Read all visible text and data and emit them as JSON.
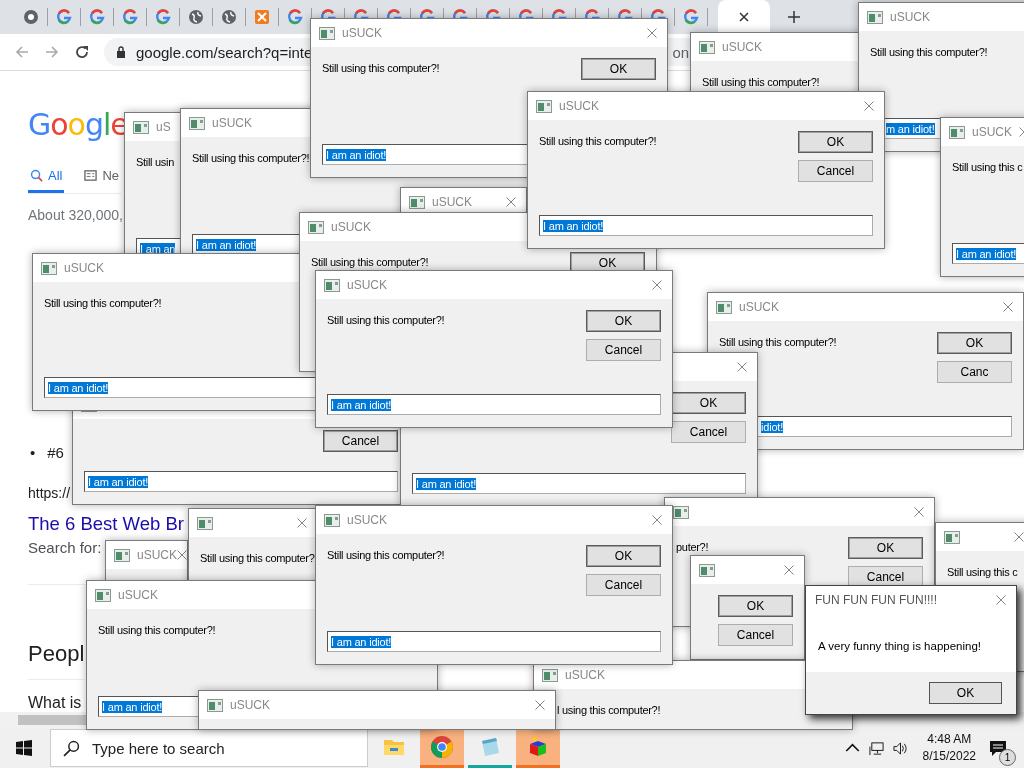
{
  "browser": {
    "address": "google.com/search?q=inte",
    "address_tail": "on",
    "logo": "Google",
    "search_tabs": [
      {
        "label": "All",
        "selected": true
      },
      {
        "label": "Ne",
        "selected": false
      }
    ],
    "result_stats": "About 320,000,",
    "list_items": [
      {
        "marker": "•",
        "text": "#6"
      }
    ],
    "result_url": "https://",
    "result_link": "The 6 Best Web Br",
    "result_snippet": "Search for:",
    "section_title": "Peopl",
    "question": "What is"
  },
  "windows": [
    {
      "kind": "prompt",
      "title": "uS",
      "message": "Still usin",
      "input": "I am an"
    },
    {
      "kind": "prompt",
      "title": "uSUCK",
      "message": "Still using this computer?!",
      "input": "I am an idiot!"
    },
    {
      "kind": "prompt",
      "title": "uSUCK",
      "message": "Still using this computer?!",
      "buttons": [
        "OK"
      ],
      "input": "I am an idiot!"
    },
    {
      "kind": "prompt",
      "title": "uSUCK",
      "message": "Still using this computer?!"
    },
    {
      "kind": "prompt",
      "title": "uSUCK",
      "message": "Still using this computer?!",
      "input": "m an idiot!"
    },
    {
      "kind": "prompt",
      "title": "uSUCK",
      "message": "Still using this c",
      "input": "I am an idiot!"
    },
    {
      "kind": "prompt",
      "buttons": [
        "Cancel"
      ],
      "input": "I am an idiot!"
    },
    {
      "kind": "prompt",
      "title": "uSUCK",
      "message": "Still using this computer?!",
      "input": "I am an idiot!"
    },
    {
      "kind": "prompt",
      "title": "uSUCK"
    },
    {
      "kind": "prompt",
      "title": "uSUCK",
      "message": "Still using this computer?!",
      "buttons": [
        "OK"
      ]
    },
    {
      "kind": "prompt",
      "title": "uSUCK",
      "message": "Still using this computer?!",
      "buttons": [
        "OK",
        "Cancel"
      ],
      "input": "I am an idiot!"
    },
    {
      "kind": "prompt",
      "title": "uSUCK",
      "message": "Still using this computer?!",
      "buttons": [
        "OK",
        "Canc"
      ],
      "input": "idiot!"
    },
    {
      "kind": "prompt",
      "buttons": [
        "OK",
        "Cancel"
      ],
      "input": "I am an idiot!"
    },
    {
      "kind": "prompt",
      "title": "uSUCK",
      "message": "Still using this computer?!",
      "buttons": [
        "OK",
        "Cancel"
      ],
      "input": "I am an idiot!"
    },
    {
      "kind": "prompt",
      "message": "puter?!",
      "buttons": [
        "OK",
        "Cancel"
      ]
    },
    {
      "kind": "prompt",
      "message": "Still using this c"
    },
    {
      "kind": "prompt",
      "buttons": [
        "OK",
        "Cancel"
      ]
    },
    {
      "kind": "prompt",
      "title": "uSUCK"
    },
    {
      "kind": "prompt",
      "message": "Still using this computer?"
    },
    {
      "kind": "prompt",
      "title": "uSUCK",
      "message": "Still using this computer?!",
      "input": "I am an idiot!"
    },
    {
      "kind": "prompt",
      "title": "uSUCK",
      "message": "l using this computer?!"
    },
    {
      "kind": "prompt",
      "title": "uSUCK"
    },
    {
      "kind": "prompt",
      "title": "uSUCK",
      "message": "Still using this computer?!",
      "buttons": [
        "OK",
        "Cancel"
      ],
      "input": "I am an idiot!"
    },
    {
      "kind": "message",
      "title": "FUN FUN FUN FUN!!!!",
      "message": "A very funny thing is happening!",
      "buttons": [
        "OK"
      ]
    }
  ],
  "taskbar": {
    "search_placeholder": "Type here to search",
    "apps": [
      {
        "kind": "folder",
        "flashing": false,
        "running": false
      },
      {
        "kind": "chrome",
        "flashing": true,
        "running": false
      },
      {
        "kind": "notepad",
        "flashing": false,
        "running": true
      },
      {
        "kind": "cube",
        "flashing": true,
        "running": false
      }
    ],
    "time": "4:48 AM",
    "date": "8/15/2022",
    "notifications": "1"
  }
}
